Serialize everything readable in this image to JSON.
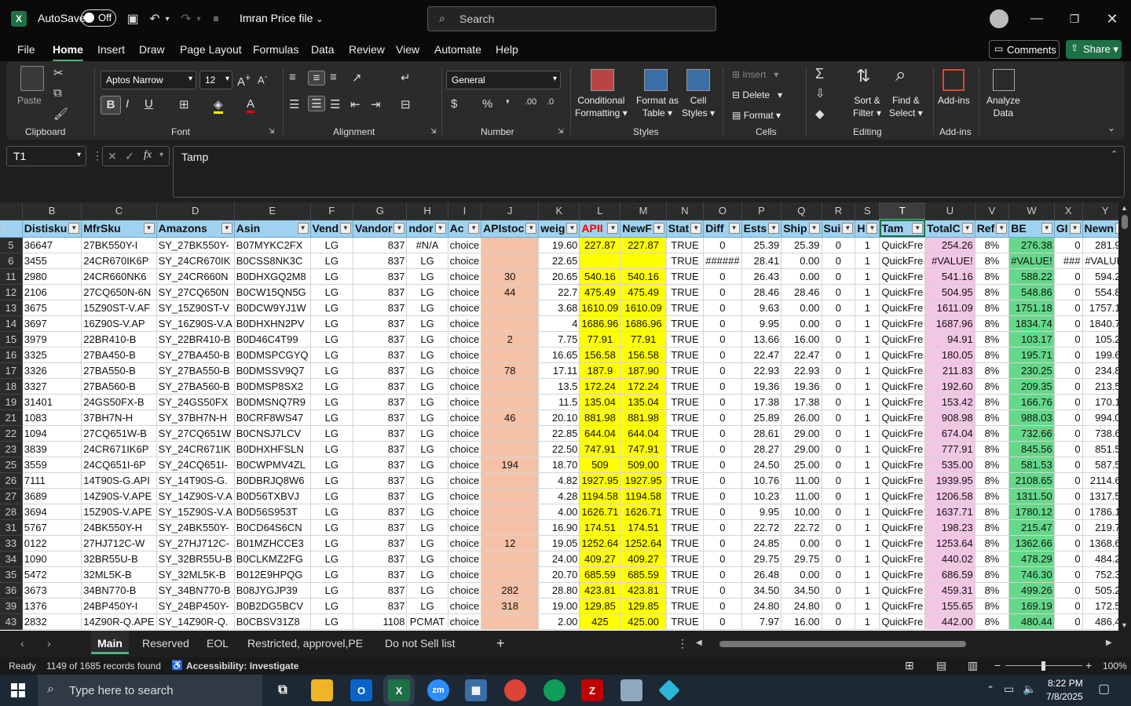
{
  "titlebar": {
    "app_icon": "excel-icon",
    "autosave": "AutoSave",
    "autosave_state": "Off",
    "filename": "Imran Price file",
    "search_placeholder": "Search"
  },
  "menu": [
    "File",
    "Home",
    "Insert",
    "Draw",
    "Page Layout",
    "Formulas",
    "Data",
    "Review",
    "View",
    "Automate",
    "Help"
  ],
  "comments": "Comments",
  "share": "Share",
  "ribbon": {
    "paste": "Paste",
    "clipboard": "Clipboard",
    "font_name": "Aptos Narrow",
    "font_size": "12",
    "font": "Font",
    "alignment": "Alignment",
    "number_format": "General",
    "number": "Number",
    "cond_fmt_1": "Conditional",
    "cond_fmt_2": "Formatting",
    "fmt_table_1": "Format as",
    "fmt_table_2": "Table",
    "cell_styles_1": "Cell",
    "cell_styles_2": "Styles",
    "styles": "Styles",
    "insert": "Insert",
    "delete": "Delete",
    "format": "Format",
    "cells": "Cells",
    "sort_1": "Sort &",
    "sort_2": "Filter",
    "find_1": "Find &",
    "find_2": "Select",
    "editing": "Editing",
    "addins": "Add-ins",
    "addins_group": "Add-ins",
    "analyze_1": "Analyze",
    "analyze_2": "Data"
  },
  "namebox": "T1",
  "formula": "Tamp",
  "columns": [
    "B",
    "C",
    "D",
    "E",
    "F",
    "G",
    "H",
    "I",
    "J",
    "K",
    "L",
    "M",
    "N",
    "O",
    "P",
    "Q",
    "R",
    "S",
    "T",
    "U",
    "V",
    "W",
    "X",
    "Y",
    "Z"
  ],
  "headers": [
    "Distisku",
    "MfrSku",
    "Amazons",
    "Asin",
    "Vend",
    "Vandor",
    "ndor",
    "Ac",
    "APIstoc",
    "weig",
    "APII",
    "NewF",
    "Stat",
    "Diff",
    "Ests",
    "Ship",
    "Sui",
    "H",
    "Tam",
    "TotalC",
    "Ref",
    "BE",
    "GI",
    "Newn",
    "Gml"
  ],
  "rows": [
    {
      "n": "5",
      "c": [
        "36647",
        "27BK550Y-I",
        "SY_27BK550Y-",
        "B07MYKC2FX",
        "LG",
        "837",
        "#N/A",
        "choice",
        "",
        "19.60",
        "227.87",
        "227.87",
        "TRUE",
        "0",
        "25.39",
        "25.39",
        "0",
        "1",
        "QuickFre",
        "254.26",
        "8%",
        "276.38",
        "0",
        "281.91",
        "5.09"
      ]
    },
    {
      "n": "6",
      "c": [
        "3455",
        "24CR670IK6P",
        "SY_24CR670IK",
        "B0CSS8NK3C",
        "LG",
        "837",
        "LG",
        "choice",
        "",
        "22.65",
        "",
        "",
        "TRUE",
        "######",
        "28.41",
        "0.00",
        "0",
        "1",
        "QuickFre",
        "#VALUE!",
        "8%",
        "#VALUE!",
        "###",
        "#VALUE!",
        "#VALU"
      ]
    },
    {
      "n": "11",
      "c": [
        "2980",
        "24CR660NK6",
        "SY_24CR660N",
        "B0DHXGQ2M8",
        "LG",
        "837",
        "LG",
        "choice",
        "30",
        "20.65",
        "540.16",
        "540.16",
        "TRUE",
        "0",
        "26.43",
        "0.00",
        "0",
        "1",
        "QuickFre",
        "541.16",
        "8%",
        "588.22",
        "0",
        "594.22",
        "5.52"
      ]
    },
    {
      "n": "12",
      "c": [
        "2106",
        "27CQ650N-6N",
        "SY_27CQ650N",
        "B0CW15QN5G",
        "LG",
        "837",
        "LG",
        "choice",
        "44",
        "22.7",
        "475.49",
        "475.49",
        "TRUE",
        "0",
        "28.46",
        "28.46",
        "0",
        "1",
        "QuickFre",
        "504.95",
        "8%",
        "548.86",
        "0",
        "554.86",
        "5.52"
      ]
    },
    {
      "n": "13",
      "c": [
        "3675",
        "15Z90ST-V.AF",
        "SY_15Z90ST-V",
        "B0DCW9YJ1W",
        "LG",
        "837",
        "LG",
        "choice",
        "",
        "3.68",
        "1610.09",
        "1610.09",
        "TRUE",
        "0",
        "9.63",
        "0.00",
        "0",
        "1",
        "QuickFre",
        "1611.09",
        "8%",
        "1751.18",
        "0",
        "1757.18",
        "5.52"
      ]
    },
    {
      "n": "14",
      "c": [
        "3697",
        "16Z90S-V.AP",
        "SY_16Z90S-V.A",
        "B0DHXHN2PV",
        "LG",
        "837",
        "LG",
        "choice",
        "",
        "4",
        "1686.96",
        "1686.96",
        "TRUE",
        "0",
        "9.95",
        "0.00",
        "0",
        "1",
        "QuickFre",
        "1687.96",
        "8%",
        "1834.74",
        "0",
        "1840.74",
        "5.53"
      ]
    },
    {
      "n": "15",
      "c": [
        "3979",
        "22BR410-B",
        "SY_22BR410-B",
        "B0D46C4T99",
        "LG",
        "837",
        "LG",
        "choice",
        "2",
        "7.75",
        "77.91",
        "77.91",
        "TRUE",
        "0",
        "13.66",
        "16.00",
        "0",
        "1",
        "QuickFre",
        "94.91",
        "8%",
        "103.17",
        "0",
        "105.23",
        "1.90"
      ]
    },
    {
      "n": "16",
      "c": [
        "3325",
        "27BA450-B",
        "SY_27BA450-B",
        "B0DMSPCGYQ",
        "LG",
        "837",
        "LG",
        "choice",
        "",
        "16.65",
        "156.58",
        "156.58",
        "TRUE",
        "0",
        "22.47",
        "22.47",
        "0",
        "1",
        "QuickFre",
        "180.05",
        "8%",
        "195.71",
        "0",
        "199.62",
        "3.60"
      ]
    },
    {
      "n": "17",
      "c": [
        "3326",
        "27BA550-B",
        "SY_27BA550-B",
        "B0DMSSV9Q7",
        "LG",
        "837",
        "LG",
        "choice",
        "78",
        "17.11",
        "187.9",
        "187.90",
        "TRUE",
        "0",
        "22.93",
        "22.93",
        "0",
        "1",
        "QuickFre",
        "211.83",
        "8%",
        "230.25",
        "0",
        "234.86",
        "4.24"
      ]
    },
    {
      "n": "18",
      "c": [
        "3327",
        "27BA560-B",
        "SY_27BA560-B",
        "B0DMSP8SX2",
        "LG",
        "837",
        "LG",
        "choice",
        "",
        "13.5",
        "172.24",
        "172.24",
        "TRUE",
        "0",
        "19.36",
        "19.36",
        "0",
        "1",
        "QuickFre",
        "192.60",
        "8%",
        "209.35",
        "0",
        "213.54",
        "3.86"
      ]
    },
    {
      "n": "19",
      "c": [
        "31401",
        "24GS50FX-B",
        "SY_24GS50FX",
        "B0DMSNQ7R9",
        "LG",
        "837",
        "LG",
        "choice",
        "",
        "11.5",
        "135.04",
        "135.04",
        "TRUE",
        "0",
        "17.38",
        "17.38",
        "0",
        "1",
        "QuickFre",
        "153.42",
        "8%",
        "166.76",
        "0",
        "170.10",
        "3.08"
      ]
    },
    {
      "n": "21",
      "c": [
        "1083",
        "37BH7N-H",
        "SY_37BH7N-H",
        "B0CRF8WS47",
        "LG",
        "837",
        "LG",
        "choice",
        "46",
        "20.10",
        "881.98",
        "881.98",
        "TRUE",
        "0",
        "25.89",
        "26.00",
        "0",
        "1",
        "QuickFre",
        "908.98",
        "8%",
        "988.03",
        "0",
        "994.03",
        "5.53"
      ]
    },
    {
      "n": "22",
      "c": [
        "1094",
        "27CQ651W-B",
        "SY_27CQ651W",
        "B0CNSJ7LCV",
        "LG",
        "837",
        "LG",
        "choice",
        "",
        "22.85",
        "644.04",
        "644.04",
        "TRUE",
        "0",
        "28.61",
        "29.00",
        "0",
        "1",
        "QuickFre",
        "674.04",
        "8%",
        "732.66",
        "0",
        "738.66",
        "5.53"
      ]
    },
    {
      "n": "23",
      "c": [
        "3839",
        "24CR671IK6P",
        "SY_24CR671IK",
        "B0DHXHFSLN",
        "LG",
        "837",
        "LG",
        "choice",
        "",
        "22.50",
        "747.91",
        "747.91",
        "TRUE",
        "0",
        "28.27",
        "29.00",
        "0",
        "1",
        "QuickFre",
        "777.91",
        "8%",
        "845.56",
        "0",
        "851.56",
        "5.53"
      ]
    },
    {
      "n": "25",
      "c": [
        "3559",
        "24CQ651I-6P",
        "SY_24CQ651I-",
        "B0CWPMV4ZL",
        "LG",
        "837",
        "LG",
        "choice",
        "194",
        "18.70",
        "509",
        "509.00",
        "TRUE",
        "0",
        "24.50",
        "25.00",
        "0",
        "1",
        "QuickFre",
        "535.00",
        "8%",
        "581.53",
        "0",
        "587.53",
        "5.53"
      ]
    },
    {
      "n": "26",
      "c": [
        "7111",
        "14T90S-G.API",
        "SY_14T90S-G.",
        "B0DBRJQ8W6",
        "LG",
        "837",
        "LG",
        "choice",
        "",
        "4.82",
        "1927.95",
        "1927.95",
        "TRUE",
        "0",
        "10.76",
        "11.00",
        "0",
        "1",
        "QuickFre",
        "1939.95",
        "8%",
        "2108.65",
        "0",
        "2114.65",
        "5.53"
      ]
    },
    {
      "n": "27",
      "c": [
        "3689",
        "14Z90S-V.APE",
        "SY_14Z90S-V.A",
        "B0D56TXBVJ",
        "LG",
        "837",
        "LG",
        "choice",
        "",
        "4.28",
        "1194.58",
        "1194.58",
        "TRUE",
        "0",
        "10.23",
        "11.00",
        "0",
        "1",
        "QuickFre",
        "1206.58",
        "8%",
        "1311.50",
        "0",
        "1317.50",
        "5.52"
      ]
    },
    {
      "n": "28",
      "c": [
        "3694",
        "15Z90S-V.APE",
        "SY_15Z90S-V.A",
        "B0D56S953T",
        "LG",
        "837",
        "LG",
        "choice",
        "",
        "4.00",
        "1626.71",
        "1626.71",
        "TRUE",
        "0",
        "9.95",
        "10.00",
        "0",
        "1",
        "QuickFre",
        "1637.71",
        "8%",
        "1780.12",
        "0",
        "1786.12",
        "5.53"
      ]
    },
    {
      "n": "31",
      "c": [
        "5767",
        "24BK550Y-H",
        "SY_24BK550Y-",
        "B0CD64S6CN",
        "LG",
        "837",
        "LG",
        "choice",
        "",
        "16.90",
        "174.51",
        "174.51",
        "TRUE",
        "0",
        "22.72",
        "22.72",
        "0",
        "1",
        "QuickFre",
        "198.23",
        "8%",
        "215.47",
        "0",
        "219.78",
        "3.97"
      ]
    },
    {
      "n": "33",
      "c": [
        "0122",
        "27HJ712C-W",
        "SY_27HJ712C-",
        "B01MZHCCE3",
        "LG",
        "837",
        "LG",
        "choice",
        "12",
        "19.05",
        "1252.64",
        "1252.64",
        "TRUE",
        "0",
        "24.85",
        "0.00",
        "0",
        "1",
        "QuickFre",
        "1253.64",
        "8%",
        "1362.66",
        "0",
        "1368.66",
        "5.53"
      ]
    },
    {
      "n": "34",
      "c": [
        "1090",
        "32BR55U-B",
        "SY_32BR55U-B",
        "B0CLKMZ2FG",
        "LG",
        "837",
        "LG",
        "choice",
        "",
        "24.00",
        "409.27",
        "409.27",
        "TRUE",
        "0",
        "29.75",
        "29.75",
        "0",
        "1",
        "QuickFre",
        "440.02",
        "8%",
        "478.29",
        "0",
        "484.29",
        "5.53"
      ]
    },
    {
      "n": "35",
      "c": [
        "5472",
        "32ML5K-B",
        "SY_32ML5K-B",
        "B012E9HPQG",
        "LG",
        "837",
        "LG",
        "choice",
        "",
        "20.70",
        "685.59",
        "685.59",
        "TRUE",
        "0",
        "26.48",
        "0.00",
        "0",
        "1",
        "QuickFre",
        "686.59",
        "8%",
        "746.30",
        "0",
        "752.30",
        "5.53"
      ]
    },
    {
      "n": "36",
      "c": [
        "3673",
        "34BN770-B",
        "SY_34BN770-B",
        "B08JYGJP39",
        "LG",
        "837",
        "LG",
        "choice",
        "282",
        "28.80",
        "423.81",
        "423.81",
        "TRUE",
        "0",
        "34.50",
        "34.50",
        "0",
        "1",
        "QuickFre",
        "459.31",
        "8%",
        "499.26",
        "0",
        "505.26",
        "5.53"
      ]
    },
    {
      "n": "39",
      "c": [
        "1376",
        "24BP450Y-I",
        "SY_24BP450Y-",
        "B0B2DG5BCV",
        "LG",
        "837",
        "LG",
        "choice",
        "318",
        "19.00",
        "129.85",
        "129.85",
        "TRUE",
        "0",
        "24.80",
        "24.80",
        "0",
        "1",
        "QuickFre",
        "155.65",
        "8%",
        "169.19",
        "0",
        "172.57",
        "3.12"
      ]
    },
    {
      "n": "43",
      "c": [
        "2832",
        "14Z90R-Q.APE",
        "SY_14Z90R-Q.",
        "B0CBSV31Z8",
        "LG",
        "1108",
        "PCMAT",
        "choice",
        "",
        "2.00",
        "425",
        "425.00",
        "TRUE",
        "0",
        "7.97",
        "16.00",
        "0",
        "1",
        "QuickFre",
        "442.00",
        "8%",
        "480.44",
        "0",
        "486.44",
        "5.52"
      ]
    }
  ],
  "sheets": [
    "Main",
    "Reserved",
    "EOL",
    "Restricted, approvel,PE",
    "Do not Sell list"
  ],
  "status": {
    "ready": "Ready",
    "records": "1149 of 1685 records found",
    "accessibility": "Accessibility: Investigate",
    "zoom": "100%"
  },
  "taskbar": {
    "search_placeholder": "Type here to search",
    "time": "8:22 PM",
    "date": "7/8/2025"
  },
  "colors": {
    "accent": "#4fb37a",
    "header_fill": "#9fd2f0",
    "peach": "#f5c2a8",
    "yellow": "#ffff00",
    "pink": "#f2c6e4",
    "green": "#65d88a"
  }
}
